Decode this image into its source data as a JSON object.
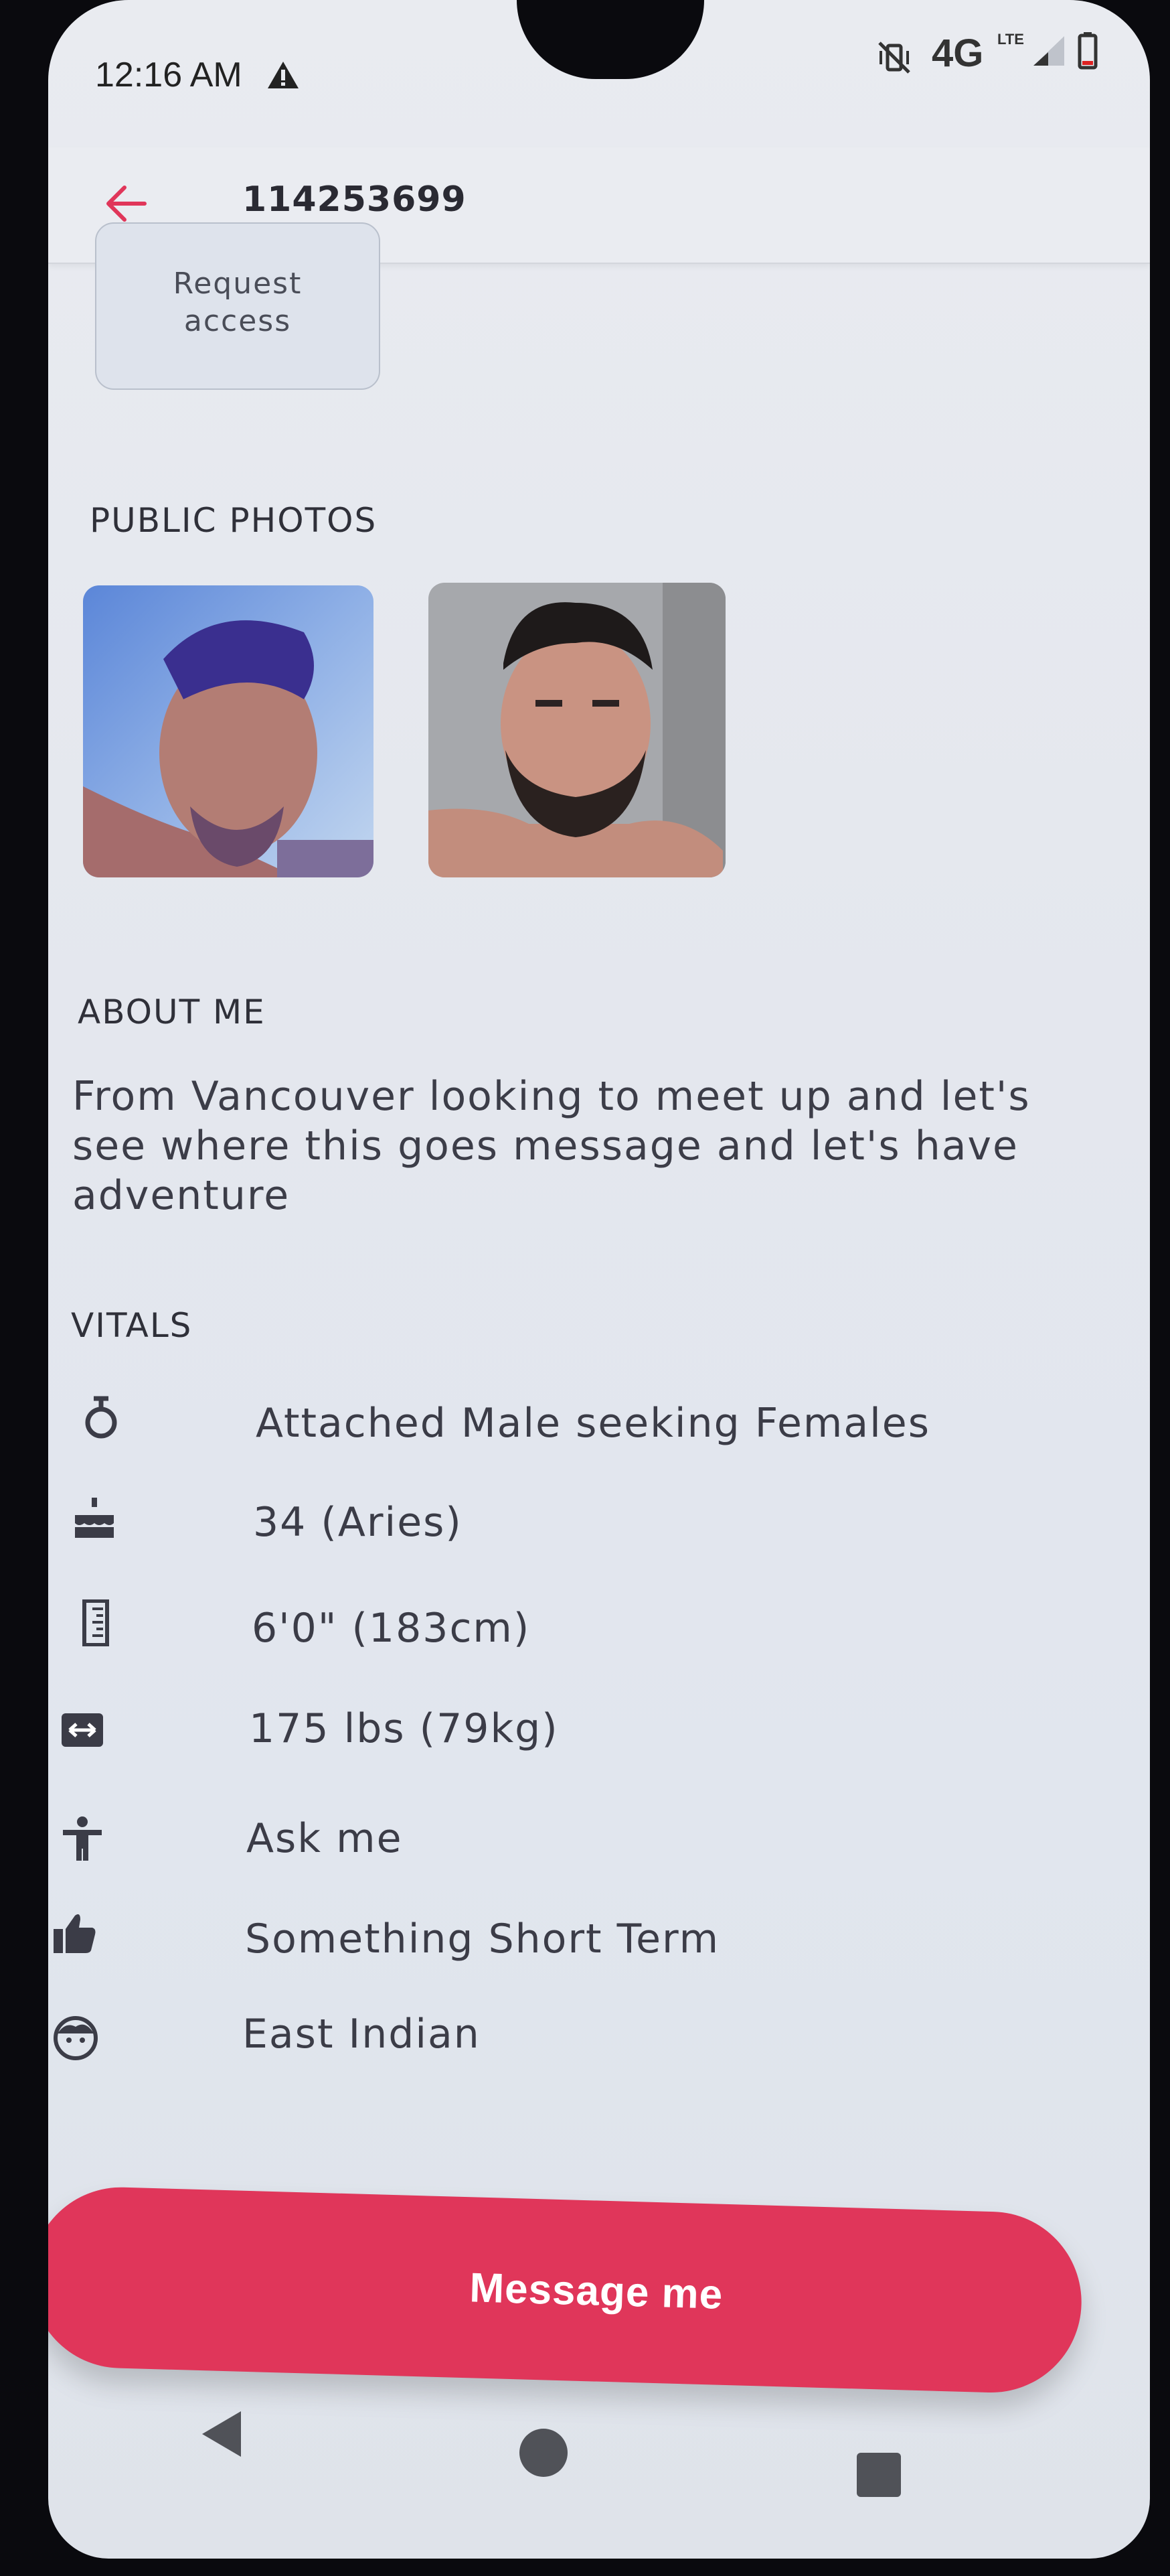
{
  "status_bar": {
    "time": "12:16 AM",
    "network": "4G",
    "network_sub": "LTE"
  },
  "header": {
    "title": "114253699",
    "back_icon": "arrow-left-icon"
  },
  "request_access": {
    "label": "Request access"
  },
  "public_photos": {
    "title": "PUBLIC PHOTOS",
    "count_visible": 2
  },
  "about": {
    "title": "ABOUT ME",
    "text": "From Vancouver looking to meet up and let's see where this goes message and let's have adventure"
  },
  "vitals": {
    "title": "VITALS",
    "items": [
      {
        "icon": "gender-icon",
        "text": "Attached Male seeking Females"
      },
      {
        "icon": "birthday-cake-icon",
        "text": "34 (Aries)"
      },
      {
        "icon": "ruler-icon",
        "text": "6'0\" (183cm)"
      },
      {
        "icon": "weight-arrows-icon",
        "text": "175 lbs (79kg)"
      },
      {
        "icon": "body-type-icon",
        "text": "Ask me"
      },
      {
        "icon": "thumbs-up-icon",
        "text": "Something Short Term"
      },
      {
        "icon": "face-icon",
        "text": "East Indian"
      }
    ]
  },
  "cta": {
    "label": "Message me"
  },
  "colors": {
    "accent": "#e0365a",
    "text": "#3b3c47"
  }
}
